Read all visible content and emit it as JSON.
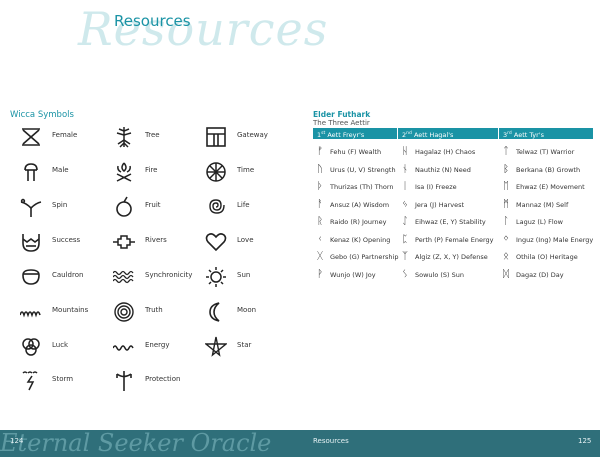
{
  "header": {
    "title": "Resources",
    "script_title": "Resources"
  },
  "wicca": {
    "heading": "Wicca Symbols",
    "items": [
      {
        "label": "Female",
        "icon": "female-symbol-icon"
      },
      {
        "label": "Male",
        "icon": "male-symbol-icon"
      },
      {
        "label": "Spin",
        "icon": "spin-symbol-icon"
      },
      {
        "label": "Success",
        "icon": "success-symbol-icon"
      },
      {
        "label": "Cauldron",
        "icon": "cauldron-symbol-icon"
      },
      {
        "label": "Mountains",
        "icon": "mountains-symbol-icon"
      },
      {
        "label": "Luck",
        "icon": "luck-symbol-icon"
      },
      {
        "label": "Storm",
        "icon": "storm-symbol-icon"
      },
      {
        "label": "Tree",
        "icon": "tree-symbol-icon"
      },
      {
        "label": "Fire",
        "icon": "fire-symbol-icon"
      },
      {
        "label": "Fruit",
        "icon": "fruit-symbol-icon"
      },
      {
        "label": "Rivers",
        "icon": "rivers-symbol-icon"
      },
      {
        "label": "Synchronicity",
        "icon": "synchronicity-symbol-icon"
      },
      {
        "label": "Truth",
        "icon": "truth-symbol-icon"
      },
      {
        "label": "Energy",
        "icon": "energy-symbol-icon"
      },
      {
        "label": "Protection",
        "icon": "protection-symbol-icon"
      },
      {
        "label": "Gateway",
        "icon": "gateway-symbol-icon"
      },
      {
        "label": "Time",
        "icon": "time-symbol-icon"
      },
      {
        "label": "Life",
        "icon": "life-symbol-icon"
      },
      {
        "label": "Love",
        "icon": "love-symbol-icon"
      },
      {
        "label": "Sun",
        "icon": "sun-symbol-icon"
      },
      {
        "label": "Moon",
        "icon": "moon-symbol-icon"
      },
      {
        "label": "Star",
        "icon": "star-symbol-icon"
      }
    ]
  },
  "futhark": {
    "title": "Elder Futhark",
    "subtitle": "The Three Aettir",
    "columns": [
      {
        "ordinal": "1",
        "suffix": "st",
        "name": "Aett Freyr's",
        "runes": [
          {
            "glyph": "ᚠ",
            "text": "Fehu (F) Wealth"
          },
          {
            "glyph": "ᚢ",
            "text": "Urus (U, V) Strength"
          },
          {
            "glyph": "ᚦ",
            "text": "Thurizas (Th) Thorn"
          },
          {
            "glyph": "ᚨ",
            "text": "Ansuz (A) Wisdom"
          },
          {
            "glyph": "ᚱ",
            "text": "Raido (R) Journey"
          },
          {
            "glyph": "ᚲ",
            "text": "Kenaz (K) Opening"
          },
          {
            "glyph": "ᚷ",
            "text": "Gebo (G) Partnership"
          },
          {
            "glyph": "ᚹ",
            "text": "Wunjo (W) Joy"
          }
        ]
      },
      {
        "ordinal": "2",
        "suffix": "nd",
        "name": "Aett Hagal's",
        "runes": [
          {
            "glyph": "ᚺ",
            "text": "Hagalaz (H) Chaos"
          },
          {
            "glyph": "ᚾ",
            "text": "Nauthiz (N) Need"
          },
          {
            "glyph": "ᛁ",
            "text": "Isa (I) Freeze"
          },
          {
            "glyph": "ᛃ",
            "text": "Jera (J) Harvest"
          },
          {
            "glyph": "ᛇ",
            "text": "Eihwaz (E, Y) Stability"
          },
          {
            "glyph": "ᛈ",
            "text": "Perth (P) Female Energy"
          },
          {
            "glyph": "ᛉ",
            "text": "Algiz (Z, X, Y) Defense"
          },
          {
            "glyph": "ᛊ",
            "text": "Sowulo (S) Sun"
          }
        ]
      },
      {
        "ordinal": "3",
        "suffix": "rd",
        "name": "Aett Tyr's",
        "runes": [
          {
            "glyph": "ᛏ",
            "text": "Telwaz (T) Warrior"
          },
          {
            "glyph": "ᛒ",
            "text": "Berkana (B) Growth"
          },
          {
            "glyph": "ᛖ",
            "text": "Ehwaz (E) Movement"
          },
          {
            "glyph": "ᛗ",
            "text": "Mannaz (M) Self"
          },
          {
            "glyph": "ᛚ",
            "text": "Laguz (L) Flow"
          },
          {
            "glyph": "ᛜ",
            "text": "Inguz (Ing) Male Energy"
          },
          {
            "glyph": "ᛟ",
            "text": "Othila (O) Heritage"
          },
          {
            "glyph": "ᛞ",
            "text": "Dagaz (D) Day"
          }
        ]
      }
    ]
  },
  "footer": {
    "script": "Eternal Seeker Oracle",
    "left_page": "124",
    "section": "Resources",
    "right_page": "125"
  },
  "colors": {
    "accent": "#1a93a5",
    "footer_band": "#2f6f7a"
  }
}
